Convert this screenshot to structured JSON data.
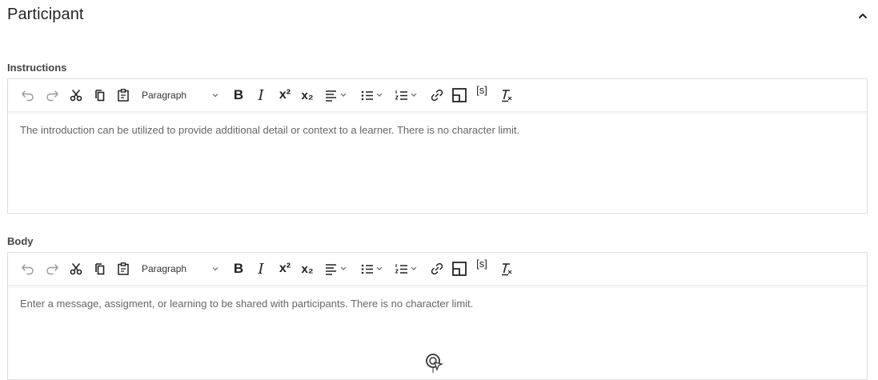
{
  "section": {
    "title": "Participant"
  },
  "icons": {
    "collapse": "chevron-up-icon",
    "undo": "undo-icon",
    "redo": "redo-icon",
    "cut": "cut-icon",
    "copy": "copy-icon",
    "paste": "paste-icon",
    "bold": "bold-icon",
    "italic": "italic-icon",
    "superscript": "superscript-icon",
    "subscript": "subscript-icon",
    "align": "align-left-icon",
    "bullet_list": "bullet-list-icon",
    "numbered_list": "numbered-list-icon",
    "link": "link-icon",
    "media": "insert-media-icon",
    "placeholder": "placeholder-tag-icon",
    "clear": "clear-formatting-icon",
    "cursor": "busy-cursor-icon"
  },
  "toolbar": {
    "format_value": "Paragraph",
    "bold_glyph": "B",
    "italic_glyph": "I",
    "superscript_glyph": "x²",
    "subscript_glyph": "x₂",
    "placeholder_glyph": "[s]",
    "clear_glyph": "Tx"
  },
  "instructions": {
    "label": "Instructions",
    "content": "The introduction can be utilized to provide additional detail or context to a learner. There is no character limit."
  },
  "body_field": {
    "label": "Body",
    "content": "Enter a message, assigment, or learning to be shared with participants. There is no character limit."
  },
  "colors": {
    "border": "#dcdfe3",
    "text": "#666666",
    "title": "#1f2329",
    "icon": "#333333"
  }
}
